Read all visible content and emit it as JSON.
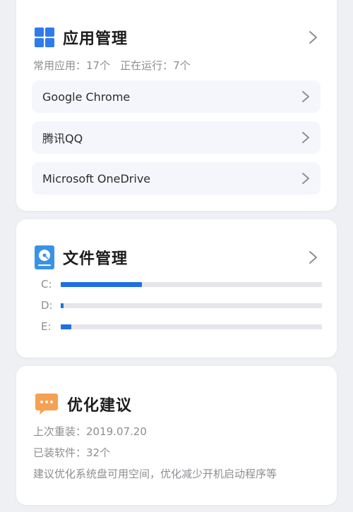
{
  "app_management": {
    "title": "应用管理",
    "icon": "grid-icon",
    "stats": {
      "common": "常用应用：17个",
      "running": "正在运行：7个"
    },
    "items": [
      {
        "label": "Google Chrome"
      },
      {
        "label": "腾讯QQ"
      },
      {
        "label": "Microsoft OneDrive"
      }
    ]
  },
  "file_management": {
    "title": "文件管理",
    "icon": "hard-drive-icon",
    "drives": [
      {
        "label": "C:",
        "usage": 0.31
      },
      {
        "label": "D:",
        "usage": 0.012
      },
      {
        "label": "E:",
        "usage": 0.04
      }
    ]
  },
  "optimization": {
    "title": "优化建议",
    "icon": "chat-bubble-icon",
    "last_reinstall": "上次重装：2019.07.20",
    "installed": "已装软件：32个",
    "suggestion": "建议优化系统盘可用空间，优化减少开机启动程序等"
  },
  "colors": {
    "accent": "#1f6fe5",
    "app_icon": "#2f7bea",
    "drive_icon": "#3a92e8",
    "chat_icon": "#f5a152"
  }
}
